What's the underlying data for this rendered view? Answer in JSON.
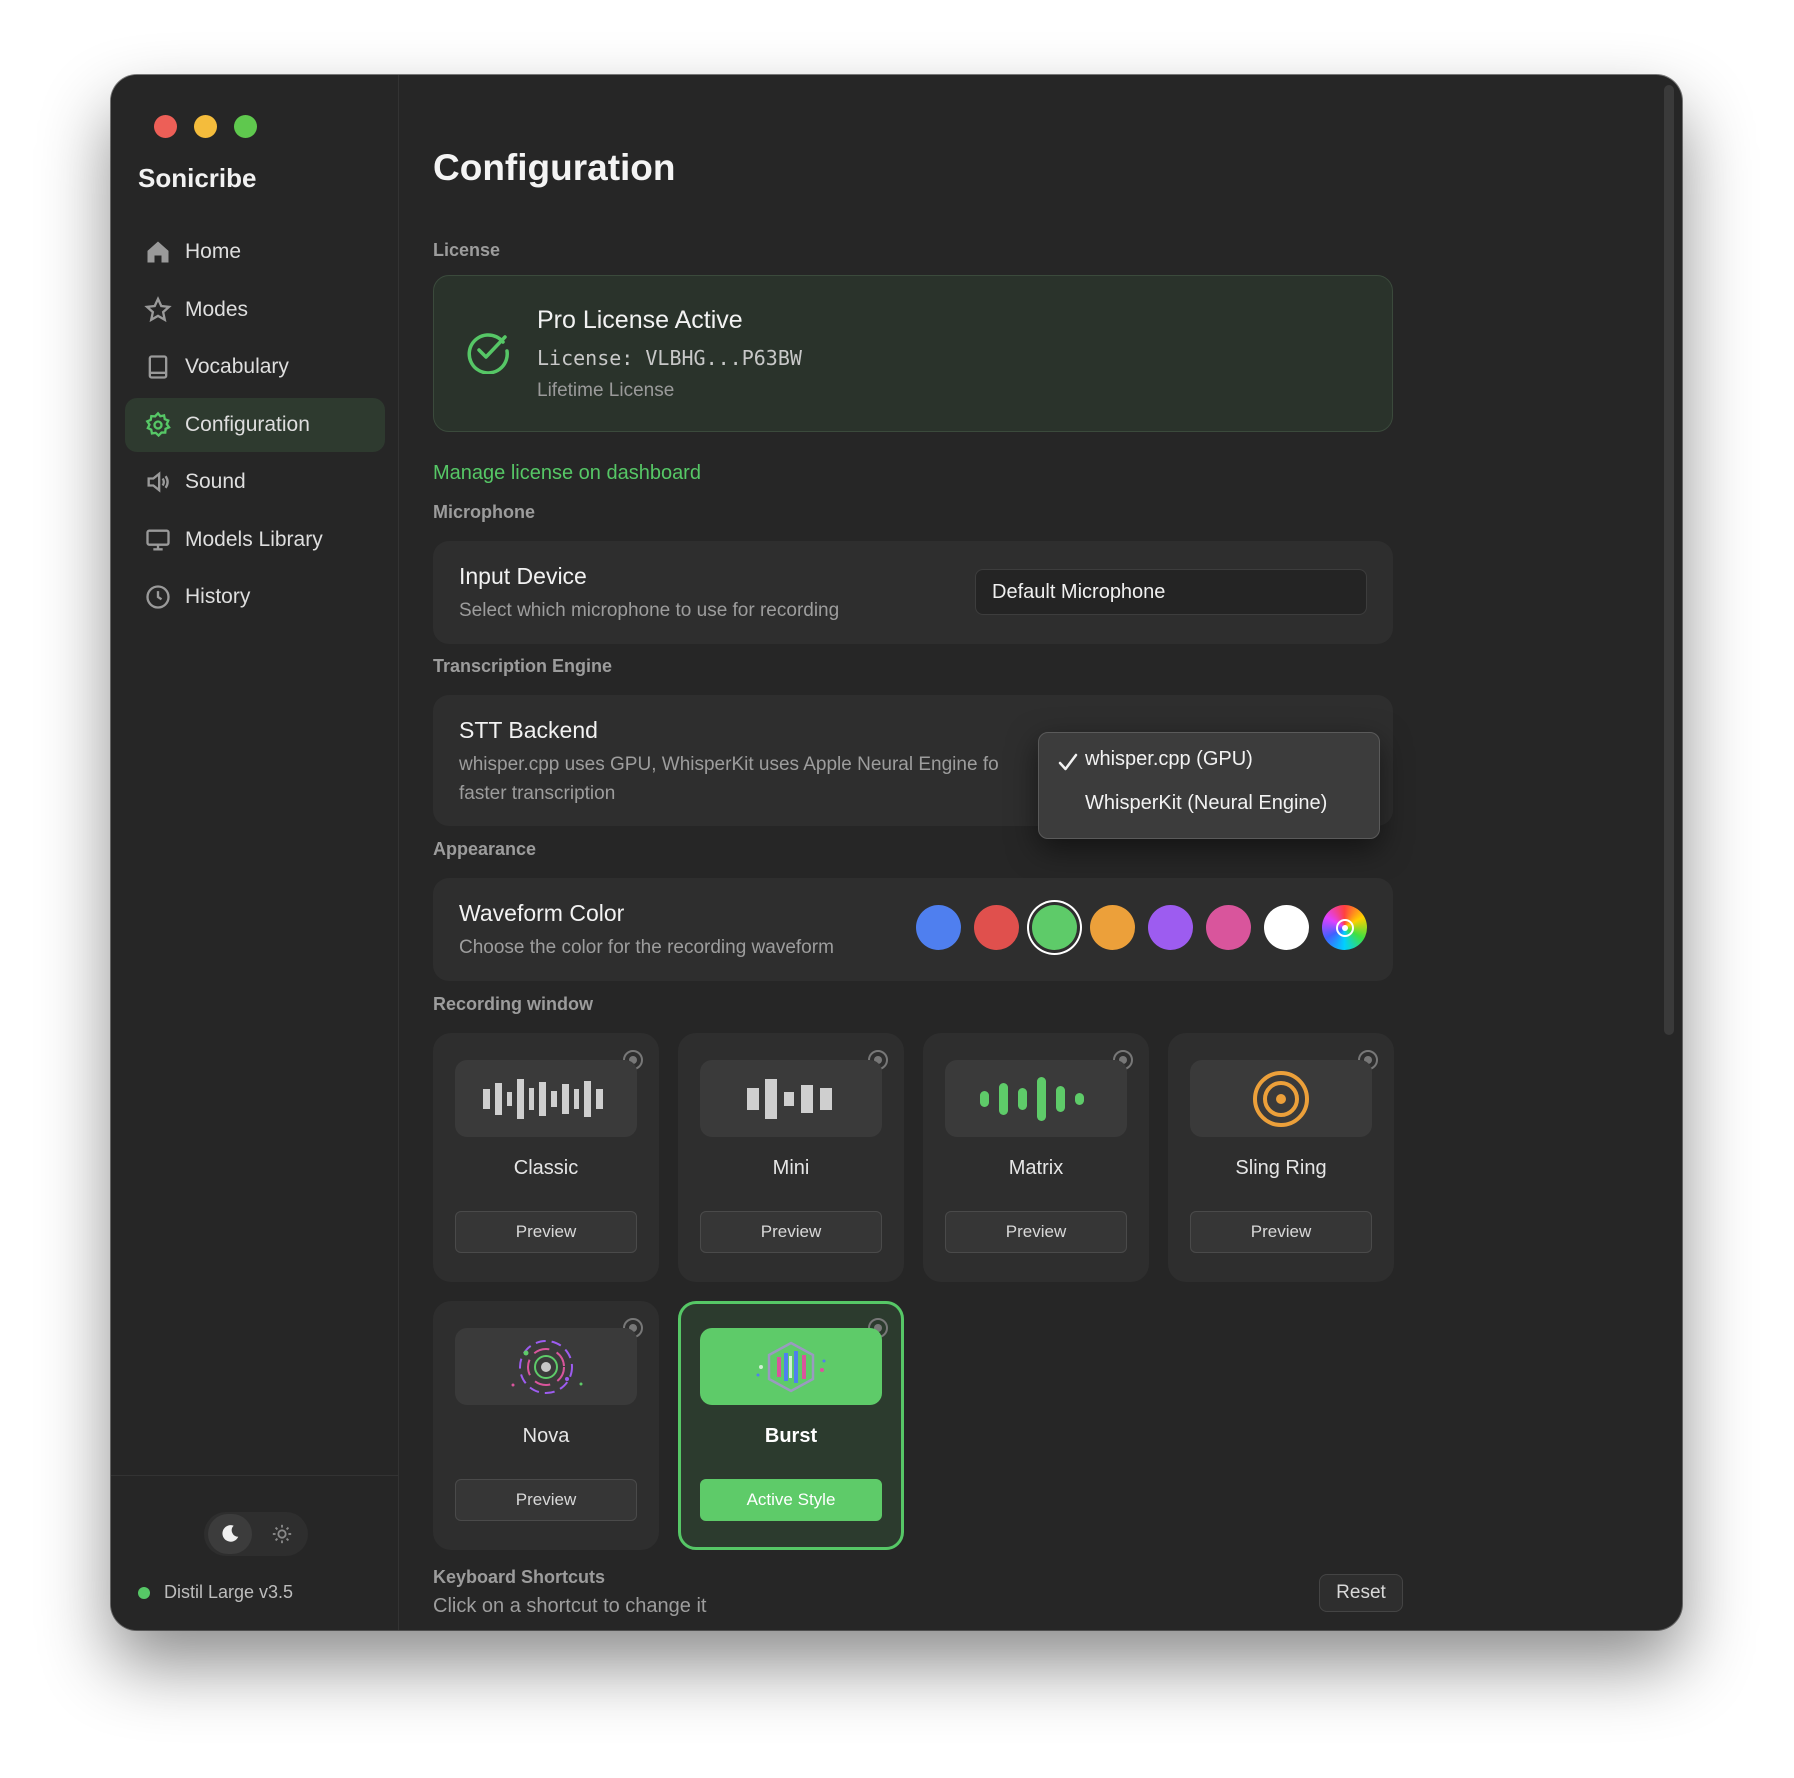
{
  "app": {
    "name": "Sonicribe"
  },
  "sidebar": {
    "items": [
      {
        "label": "Home",
        "icon": "home-icon"
      },
      {
        "label": "Modes",
        "icon": "star-icon"
      },
      {
        "label": "Vocabulary",
        "icon": "book-icon"
      },
      {
        "label": "Configuration",
        "icon": "gear-icon",
        "active": true
      },
      {
        "label": "Sound",
        "icon": "speaker-icon"
      },
      {
        "label": "Models Library",
        "icon": "monitor-icon"
      },
      {
        "label": "History",
        "icon": "clock-icon"
      }
    ],
    "theme": "dark",
    "model_status": "Distil Large v3.5"
  },
  "page": {
    "title": "Configuration"
  },
  "license": {
    "section": "License",
    "title": "Pro License Active",
    "key": "License: VLBHG...P63BW",
    "type": "Lifetime License",
    "manage_link": "Manage license on dashboard"
  },
  "microphone": {
    "section": "Microphone",
    "title": "Input Device",
    "subtitle": "Select which microphone to use for recording",
    "selected": "Default Microphone"
  },
  "engine": {
    "section": "Transcription Engine",
    "title": "STT Backend",
    "subtitle_line1": "whisper.cpp uses GPU, WhisperKit uses Apple Neural Engine fo",
    "subtitle_line2": "faster transcription",
    "options": [
      "whisper.cpp (GPU)",
      "WhisperKit (Neural Engine)"
    ],
    "selected": "whisper.cpp (GPU)"
  },
  "appearance": {
    "section": "Appearance",
    "title": "Waveform Color",
    "subtitle": "Choose the color for the recording waveform",
    "colors": [
      "#4f7fef",
      "#e0504d",
      "#5ecb69",
      "#eca03a",
      "#9d5cf0",
      "#d9559c",
      "#ffffff",
      "rainbow"
    ],
    "selected_color": "#5ecb69"
  },
  "recording_window": {
    "section": "Recording window",
    "styles": [
      {
        "name": "Classic",
        "button": "Preview"
      },
      {
        "name": "Mini",
        "button": "Preview"
      },
      {
        "name": "Matrix",
        "button": "Preview"
      },
      {
        "name": "Sling Ring",
        "button": "Preview"
      },
      {
        "name": "Nova",
        "button": "Preview"
      },
      {
        "name": "Burst",
        "button": "Active Style",
        "active": true
      }
    ]
  },
  "shortcuts": {
    "section": "Keyboard Shortcuts",
    "subtitle": "Click on a shortcut to change it",
    "reset": "Reset"
  }
}
